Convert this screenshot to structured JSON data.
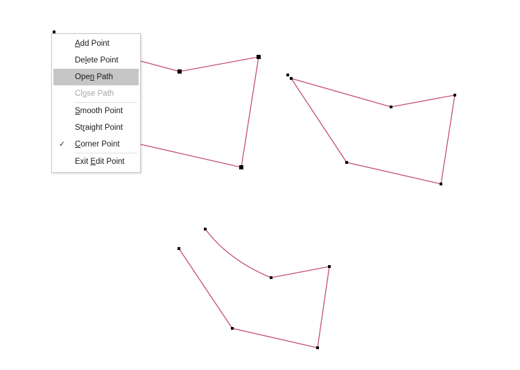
{
  "colors": {
    "path_stroke": "#c2506a",
    "vertex": "#000000",
    "menu_highlight": "#c6c6c6",
    "menu_disabled_text": "#a6a6a6"
  },
  "context_menu": {
    "items": [
      {
        "pre": "",
        "key": "A",
        "post": "dd Point",
        "state": "normal",
        "checked": false
      },
      {
        "pre": "De",
        "key": "l",
        "post": "ete Point",
        "state": "normal",
        "checked": false
      },
      {
        "pre": "Ope",
        "key": "n",
        "post": " Path",
        "state": "highlighted",
        "checked": false
      },
      {
        "pre": "Cl",
        "key": "o",
        "post": "se Path",
        "state": "disabled",
        "checked": false
      },
      {
        "pre": "",
        "key": "S",
        "post": "mooth Point",
        "state": "normal",
        "checked": false
      },
      {
        "pre": "St",
        "key": "r",
        "post": "aight Point",
        "state": "normal",
        "checked": false
      },
      {
        "pre": "",
        "key": "C",
        "post": "orner Point",
        "state": "normal",
        "checked": true
      },
      {
        "pre": "Exit ",
        "key": "E",
        "post": "dit Point",
        "state": "normal",
        "checked": false
      }
    ],
    "check_glyph": "✓"
  }
}
